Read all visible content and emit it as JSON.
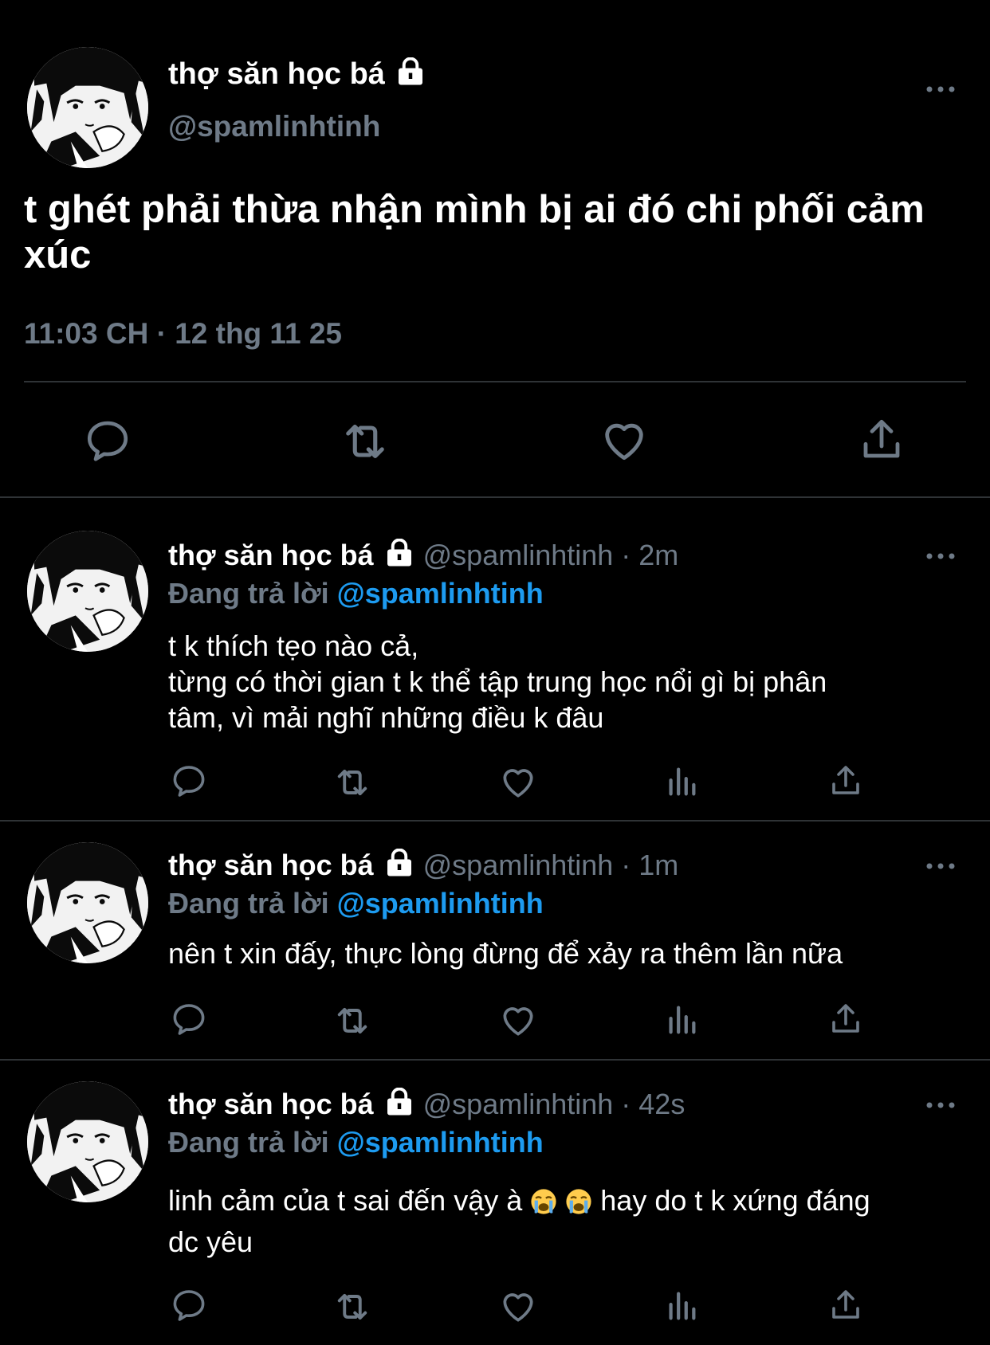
{
  "main_tweet": {
    "display_name": "thợ săn học bá",
    "handle": "@spamlinhtinh",
    "text": "t ghét phải thừa nhận mình bị ai đó chi phối cảm xúc",
    "timestamp": "11:03 CH · 12 thg 11 25",
    "icons": [
      "lock-icon",
      "more-icon",
      "reply-icon",
      "retweet-icon",
      "like-icon",
      "share-icon"
    ]
  },
  "replies": [
    {
      "display_name": "thợ săn học bá",
      "meta": "@spamlinhtinh · 2m",
      "replying_label": "Đang trả lời",
      "replying_to": "@spamlinhtinh",
      "text_lines": [
        "t k thích tẹo nào cả,",
        "từng có thời gian t k thể tập trung học nổi gì bị phân",
        "tâm, vì mải nghĩ những điều k đâu"
      ]
    },
    {
      "display_name": "thợ săn học bá",
      "meta": "@spamlinhtinh · 1m",
      "replying_label": "Đang trả lời",
      "replying_to": "@spamlinhtinh",
      "text_lines": [
        "nên t xin đấy, thực lòng đừng để xảy ra thêm lần nữa"
      ]
    },
    {
      "display_name": "thợ săn học bá",
      "meta": "@spamlinhtinh · 42s",
      "replying_label": "Đang trả lời",
      "replying_to": "@spamlinhtinh",
      "text_before_emoji": "linh cảm của t sai đến vậy à",
      "emoji": [
        "loudly-crying-face",
        "loudly-crying-face"
      ],
      "text_after_emoji": "hay do t k xứng đáng",
      "text_line2": "dc yêu"
    }
  ],
  "colors": {
    "background": "#000000",
    "secondary_text": "#6e7a87",
    "accent": "#1d9bf0",
    "divider": "#2f3336"
  }
}
